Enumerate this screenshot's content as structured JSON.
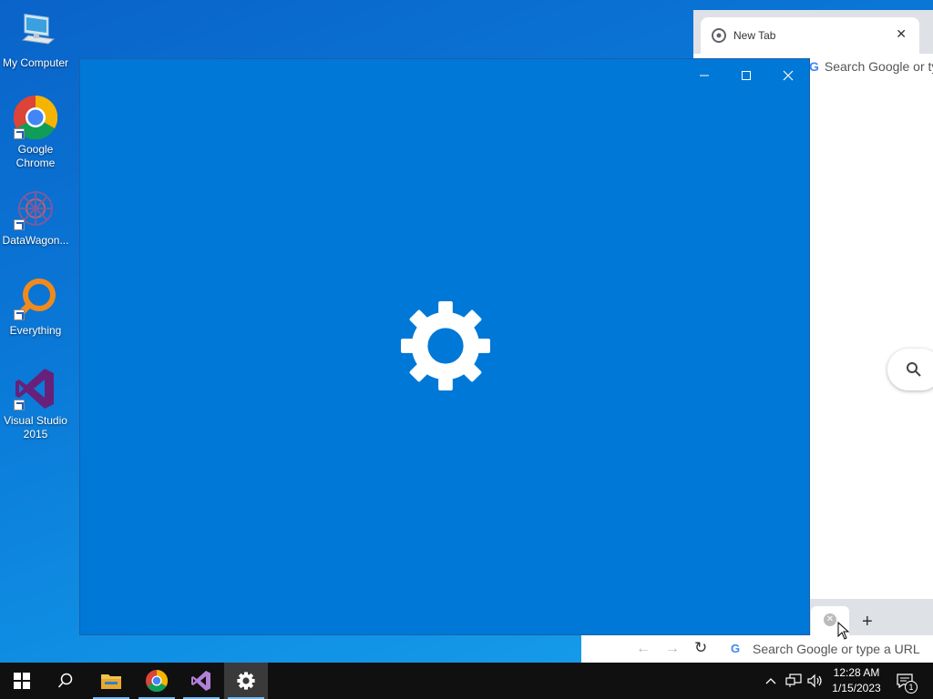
{
  "desktop": {
    "icons": [
      {
        "label_line1": "My Computer",
        "label_line2": ""
      },
      {
        "label_line1": "Google",
        "label_line2": "Chrome"
      },
      {
        "label_line1": "DataWagon...",
        "label_line2": ""
      },
      {
        "label_line1": "Everything",
        "label_line2": ""
      },
      {
        "label_line1": "Visual Studio",
        "label_line2": "2015"
      }
    ]
  },
  "chrome": {
    "tab_title": "New Tab",
    "omnibox_top": "Search Google or ty",
    "omnibox_bottom": "Search Google or type a URL",
    "new_tab_symbol": "+"
  },
  "settings_window": {
    "accent": "#0078d7"
  },
  "taskbar": {
    "time": "12:28 AM",
    "date": "1/15/2023",
    "notification_count": "1"
  }
}
